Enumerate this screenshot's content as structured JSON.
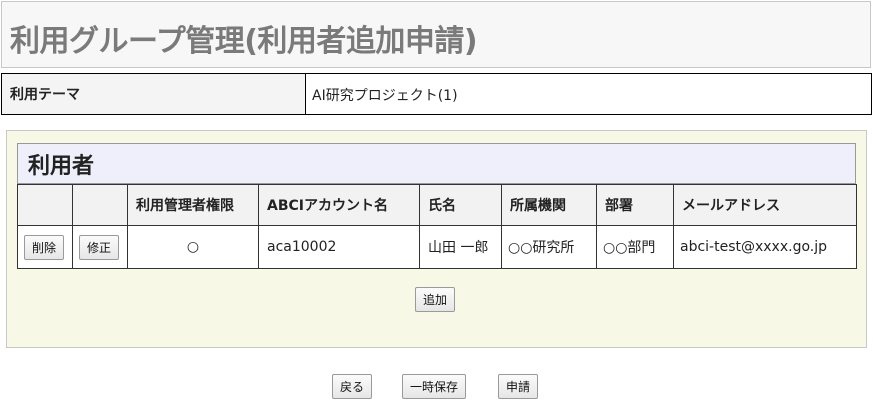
{
  "page": {
    "title": "利用グループ管理(利用者追加申請)"
  },
  "theme": {
    "label": "利用テーマ",
    "value": "AI研究プロジェクト(1)"
  },
  "users": {
    "section_title": "利用者",
    "columns": [
      "",
      "",
      "利用管理者権限",
      "ABCIアカウント名",
      "氏名",
      "所属機関",
      "部署",
      "メールアドレス"
    ],
    "rows": [
      {
        "delete_label": "削除",
        "edit_label": "修正",
        "admin": "○",
        "account": "aca10002",
        "name": "山田 一郎",
        "organization": "○○研究所",
        "department": "○○部門",
        "email": "abci-test@xxxx.go.jp"
      }
    ],
    "add_label": "追加"
  },
  "footer": {
    "back_label": "戻る",
    "save_label": "一時保存",
    "submit_label": "申請"
  }
}
